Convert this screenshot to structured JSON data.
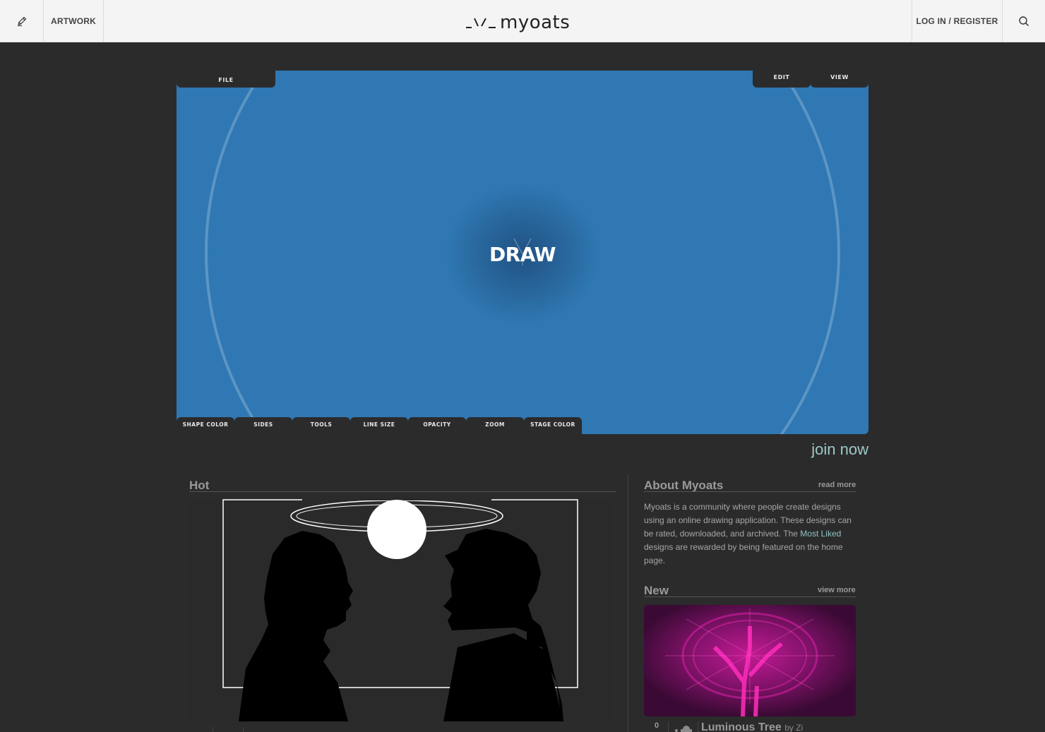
{
  "nav": {
    "pencil_icon": "pencil-icon",
    "artwork_label": "ARTWORK",
    "logo_text": "myoats",
    "login_label": "LOG IN / REGISTER",
    "search_icon": "search-icon"
  },
  "app": {
    "background_color": "#2f78b3",
    "menu": {
      "file": "file",
      "edit": "edit",
      "view": "view"
    },
    "toolbar": [
      "shape color",
      "sides",
      "tools",
      "line size",
      "opacity",
      "zoom",
      "stage color"
    ],
    "draw_label": "DRAW"
  },
  "join_now": "join now",
  "hot": {
    "title": "Hot"
  },
  "about": {
    "title": "About Myoats",
    "read_more": "read more",
    "text_before": "Myoats is a community where people create designs using an online drawing application. These designs can be rated, downloaded, and archived. The ",
    "link_text": "Most Liked",
    "text_after": " designs are rewarded by being featured on the home page."
  },
  "new": {
    "title": "New",
    "view_more": "view more",
    "item": {
      "count": "0",
      "title": "Luminous Tree",
      "by": "by Zi"
    }
  },
  "colors": {
    "accent": "#8fc5c3",
    "stage_blue": "#2f78b3",
    "page_bg": "#2b2b2b"
  }
}
